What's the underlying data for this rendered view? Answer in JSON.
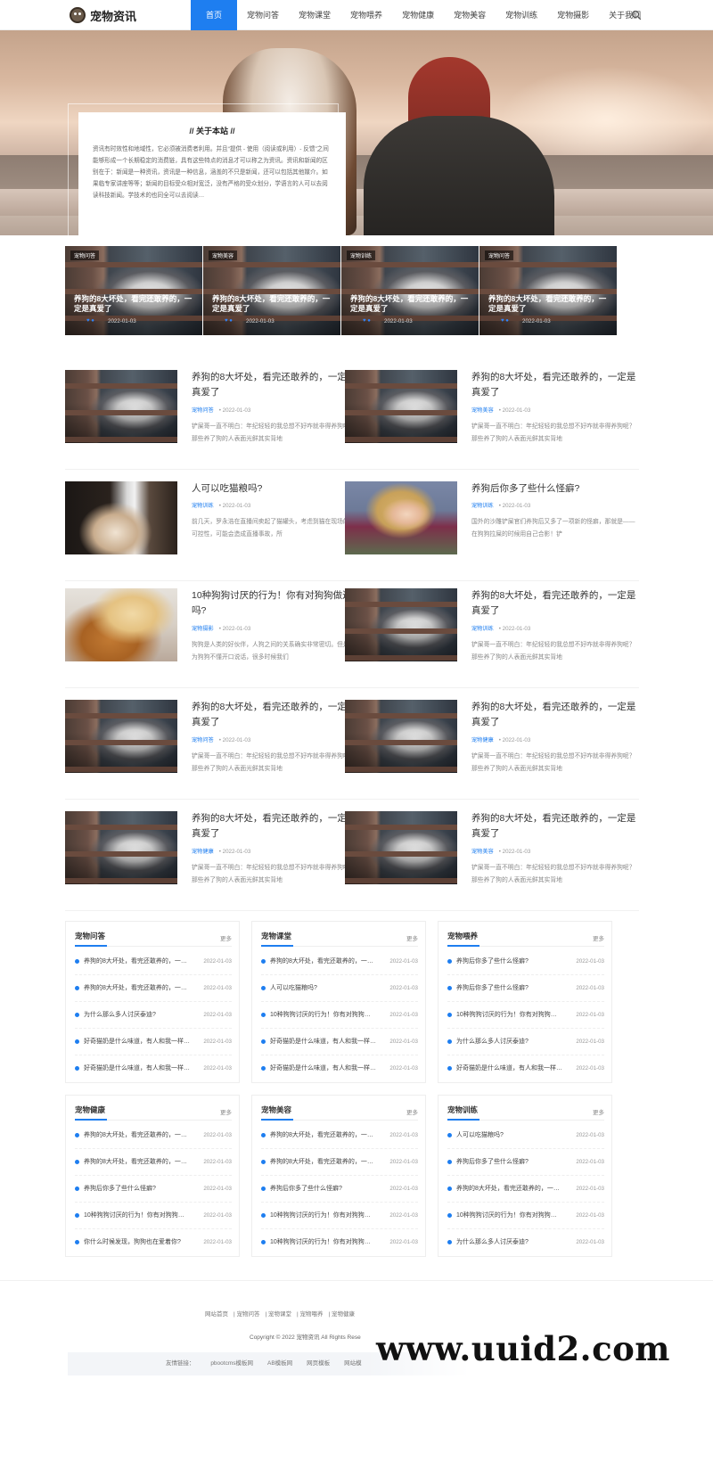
{
  "site": {
    "logo_text": "宠物资讯"
  },
  "nav": {
    "items": [
      "首页",
      "宠物问答",
      "宠物课堂",
      "宠物喂养",
      "宠物健康",
      "宠物美容",
      "宠物训练",
      "宠物摄影",
      "关于我们"
    ],
    "active_index": 0,
    "search_icon": "search-icon"
  },
  "about": {
    "title": "// 关于本站 //",
    "text": "资讯有时效性和地域性，它必须被消费者利用。并且“提供 - 使用（阅读或利用）- 反馈”之间能够形成一个长期稳定的消费链，具有这些特点的消息才可以称之为资讯。资讯和新闻的区别在于：新闻是一种资讯，资讯是一种信息，涵盖的不只是新闻，还可以包括其他媒介。如果临专家讲座等等；新闻的目标受众相对宽泛，没有严格的受众划分，学语言的人可以去阅读科技新闻。学技术的也同全可以去阅读…"
  },
  "featured": [
    {
      "tag": "宠物问答",
      "title": "养狗的8大坏处，看完还敢养的，一定是真爱了",
      "icons": "♥  ●",
      "date": "2022-01-03"
    },
    {
      "tag": "宠物美容",
      "title": "养狗的8大坏处，看完还敢养的，一定是真爱了",
      "icons": "♥  ●",
      "date": "2022-01-03"
    },
    {
      "tag": "宠物训练",
      "title": "养狗的8大坏处，看完还敢养的，一定是真爱了",
      "icons": "♥  ●",
      "date": "2022-01-03"
    },
    {
      "tag": "宠物问答",
      "title": "养狗的8大坏处，看完还敢养的，一定是真爱了",
      "icons": "♥  ●",
      "date": "2022-01-03"
    }
  ],
  "articles": [
    {
      "title": "养狗的8大坏处，看完还敢养的，一定是真爱了",
      "cat": "宠物问答",
      "date": "2022-01-03",
      "excerpt": "铲屎哥一直不明白：年纪轻轻的我总想不好咋就非得养狗呢？那些养了狗的人表面光鲜其实背地"
    },
    {
      "title": "养狗的8大坏处，看完还敢养的，一定是真爱了",
      "cat": "宠物美容",
      "date": "2022-01-03",
      "excerpt": "铲屎哥一直不明白：年纪轻轻的我总想不好咋就非得养狗呢？那些养了狗的人表面光鲜其实背地"
    },
    {
      "title": "人可以吃猫粮吗?",
      "cat": "宠物训练",
      "date": "2022-01-03",
      "excerpt": "前几天，罗永浩在直播间卖起了猫罐头，考虑到猫在现场的不可控性，可能会造成直播事故，所"
    },
    {
      "title": "养狗后你多了些什么怪癖?",
      "cat": "宠物训练",
      "date": "2022-01-03",
      "excerpt": "国外的沙雕铲屎官们养狗后又多了一项新的怪癖，那就是——在狗狗拉屎的时候用自己合影！铲"
    },
    {
      "title": "10种狗狗讨厌的行为！你有对狗狗做过吗?",
      "cat": "宠物摄影",
      "date": "2022-01-03",
      "excerpt": "狗狗是人类的好伙伴，人狗之间的关系确实非常密切。但是作为狗狗不懂开口说话，很多时候我们"
    },
    {
      "title": "养狗的8大坏处，看完还敢养的，一定是真爱了",
      "cat": "宠物训练",
      "date": "2022-01-03",
      "excerpt": "铲屎哥一直不明白：年纪轻轻的我总想不好咋就非得养狗呢？那些养了狗的人表面光鲜其实背地"
    },
    {
      "title": "养狗的8大坏处，看完还敢养的，一定是真爱了",
      "cat": "宠物问答",
      "date": "2022-01-03",
      "excerpt": "铲屎哥一直不明白：年纪轻轻的我总想不好咋就非得养狗呢？那些养了狗的人表面光鲜其实背地"
    },
    {
      "title": "养狗的8大坏处，看完还敢养的，一定是真爱了",
      "cat": "宠物健康",
      "date": "2022-01-03",
      "excerpt": "铲屎哥一直不明白：年纪轻轻的我总想不好咋就非得养狗呢？那些养了狗的人表面光鲜其实背地"
    },
    {
      "title": "养狗的8大坏处，看完还敢养的，一定是真爱了",
      "cat": "宠物健康",
      "date": "2022-01-03",
      "excerpt": "铲屎哥一直不明白：年纪轻轻的我总想不好咋就非得养狗呢？那些养了狗的人表面光鲜其实背地"
    },
    {
      "title": "养狗的8大坏处，看完还敢养的，一定是真爱了",
      "cat": "宠物美容",
      "date": "2022-01-03",
      "excerpt": "铲屎哥一直不明白：年纪轻轻的我总想不好咋就非得养狗呢？那些养了狗的人表面光鲜其实背地"
    }
  ],
  "boxes": [
    {
      "title": "宠物问答",
      "more": "更多",
      "items": [
        {
          "text": "养狗的8大坏处，看完还敢养的，一…",
          "date": "2022-01-03"
        },
        {
          "text": "养狗的8大坏处，看完还敢养的，一…",
          "date": "2022-01-03"
        },
        {
          "text": "为什么那么多人讨厌泰迪?",
          "date": "2022-01-03"
        },
        {
          "text": "好奇猫奶是什么味道，有人和我一样…",
          "date": "2022-01-03"
        },
        {
          "text": "好奇猫奶是什么味道，有人和我一样…",
          "date": "2022-01-03"
        }
      ]
    },
    {
      "title": "宠物课堂",
      "more": "更多",
      "items": [
        {
          "text": "养狗的8大坏处，看完还敢养的，一…",
          "date": "2022-01-03"
        },
        {
          "text": "人可以吃猫粮吗?",
          "date": "2022-01-03"
        },
        {
          "text": "10种狗狗讨厌的行为！你有对狗狗…",
          "date": "2022-01-03"
        },
        {
          "text": "好奇猫奶是什么味道，有人和我一样…",
          "date": "2022-01-03"
        },
        {
          "text": "好奇猫奶是什么味道，有人和我一样…",
          "date": "2022-01-03"
        }
      ]
    },
    {
      "title": "宠物喂养",
      "more": "更多",
      "items": [
        {
          "text": "养狗后你多了些什么怪癖?",
          "date": "2022-01-03"
        },
        {
          "text": "养狗后你多了些什么怪癖?",
          "date": "2022-01-03"
        },
        {
          "text": "10种狗狗讨厌的行为！你有对狗狗…",
          "date": "2022-01-03"
        },
        {
          "text": "为什么那么多人讨厌泰迪?",
          "date": "2022-01-03"
        },
        {
          "text": "好奇猫奶是什么味道，有人和我一样…",
          "date": "2022-01-03"
        }
      ]
    },
    {
      "title": "宠物健康",
      "more": "更多",
      "items": [
        {
          "text": "养狗的8大坏处，看完还敢养的，一…",
          "date": "2022-01-03"
        },
        {
          "text": "养狗的8大坏处，看完还敢养的，一…",
          "date": "2022-01-03"
        },
        {
          "text": "养狗后你多了些什么怪癖?",
          "date": "2022-01-03"
        },
        {
          "text": "10种狗狗讨厌的行为！你有对狗狗…",
          "date": "2022-01-03"
        },
        {
          "text": "你什么时候发现，狗狗也在爱着你?",
          "date": "2022-01-03"
        }
      ]
    },
    {
      "title": "宠物美容",
      "more": "更多",
      "items": [
        {
          "text": "养狗的8大坏处，看完还敢养的，一…",
          "date": "2022-01-03"
        },
        {
          "text": "养狗的8大坏处，看完还敢养的，一…",
          "date": "2022-01-03"
        },
        {
          "text": "养狗后你多了些什么怪癖?",
          "date": "2022-01-03"
        },
        {
          "text": "10种狗狗讨厌的行为！你有对狗狗…",
          "date": "2022-01-03"
        },
        {
          "text": "10种狗狗讨厌的行为！你有对狗狗…",
          "date": "2022-01-03"
        }
      ]
    },
    {
      "title": "宠物训练",
      "more": "更多",
      "items": [
        {
          "text": "人可以吃猫粮吗?",
          "date": "2022-01-03"
        },
        {
          "text": "养狗后你多了些什么怪癖?",
          "date": "2022-01-03"
        },
        {
          "text": "养狗的8大坏处，看完还敢养的，一…",
          "date": "2022-01-03"
        },
        {
          "text": "10种狗狗讨厌的行为！你有对狗狗…",
          "date": "2022-01-03"
        },
        {
          "text": "为什么那么多人讨厌泰迪?",
          "date": "2022-01-03"
        }
      ]
    }
  ],
  "footer": {
    "links": [
      "网站首页",
      "| 宠物问答",
      "| 宠物课堂",
      "| 宠物喂养",
      "| 宠物健康"
    ],
    "copyright": "Copyright © 2022 宠物资讯 All Rights Rese",
    "friends_label": "友情链接：",
    "friends": [
      "pbootcms模板网",
      "AB模板网",
      "网页模板",
      "网站模"
    ],
    "watermark": "www.uuid2.com"
  },
  "colors": {
    "accent": "#1e7ef0"
  }
}
